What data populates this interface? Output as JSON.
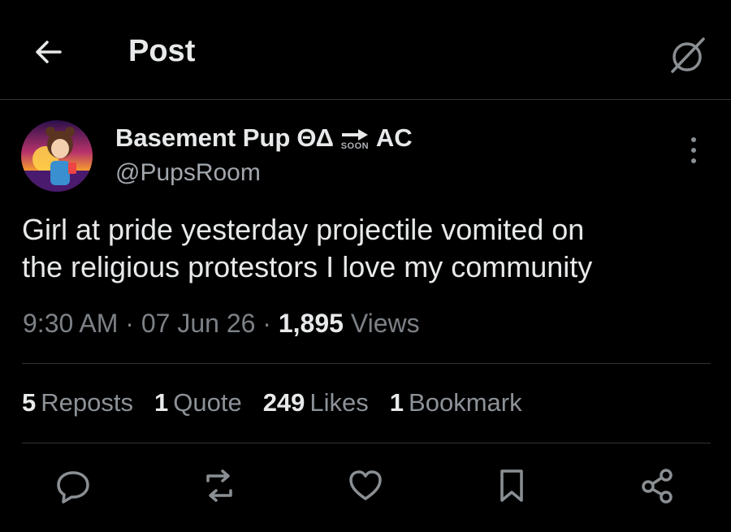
{
  "header": {
    "title": "Post"
  },
  "author": {
    "display_name": "Basement Pup",
    "name_symbols": "ΘΔ",
    "badge_text": "SOON",
    "suffix": "AC",
    "handle": "@PupsRoom"
  },
  "tweet": {
    "line1": "Girl at pride yesterday projectile vomited on",
    "line2": "the religious protestors I love my community",
    "time": "9:30 AM",
    "date": "07 Jun 26",
    "views_count": "1,895",
    "views_label": "Views"
  },
  "stats": {
    "reposts_count": "5",
    "reposts_label": "Reposts",
    "quote_count": "1",
    "quote_label": "Quote",
    "likes_count": "249",
    "likes_label": "Likes",
    "bookmark_count": "1",
    "bookmark_label": "Bookmark"
  },
  "icons": {
    "back": "arrow-left-icon",
    "header_right": "circle-slash-icon",
    "more": "more-vertical-icon",
    "reply": "reply-icon",
    "repost": "repost-icon",
    "like": "heart-icon",
    "bookmark": "bookmark-icon",
    "share": "share-icon"
  },
  "colors": {
    "background": "#000000",
    "text": "#e7e9ea",
    "muted": "#7c8186",
    "divider": "#2f3336"
  }
}
